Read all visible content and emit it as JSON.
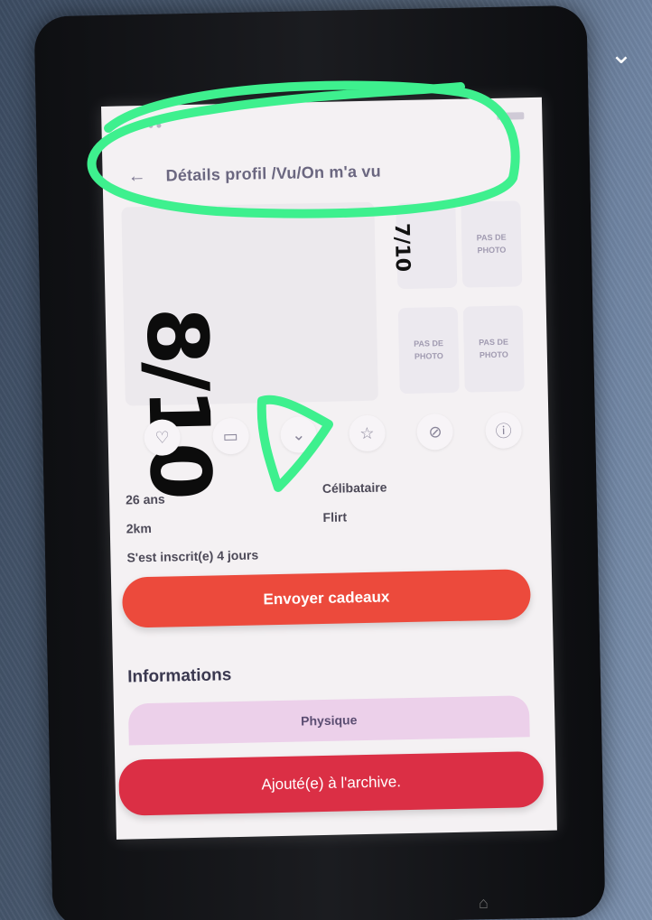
{
  "screen": {
    "header": {
      "back_icon": "arrow-left-icon",
      "title": "Détails profil /Vu/On m'a vu"
    },
    "photos": {
      "placeholder_text": "PAS DE PHOTO",
      "handwritten_big": "8/10",
      "handwritten_small": "7/10"
    },
    "actions": [
      {
        "icon": "heart-icon",
        "glyph": "♡"
      },
      {
        "icon": "chat-icon",
        "glyph": "▭"
      },
      {
        "icon": "chevron-down-icon",
        "glyph": "⌄"
      },
      {
        "icon": "star-icon",
        "glyph": "☆"
      },
      {
        "icon": "block-icon",
        "glyph": "⊘"
      },
      {
        "icon": "info-icon",
        "glyph": "ⓘ"
      }
    ],
    "profile": {
      "age": "26 ans",
      "distance": "2km",
      "joined": "S'est inscrit(e) 4 jours",
      "status": "Célibataire",
      "intent": "Flirt"
    },
    "gift_button": "Envoyer cadeaux",
    "section_title": "Informations",
    "physique_tab": "Physique",
    "archive_button": "Ajouté(e) à l'archive."
  },
  "colors": {
    "accent_red": "#ec4a3c",
    "archive_red": "#db2f45",
    "annotation_green": "#3ef08e",
    "physique_pink": "#ecd0ea"
  }
}
